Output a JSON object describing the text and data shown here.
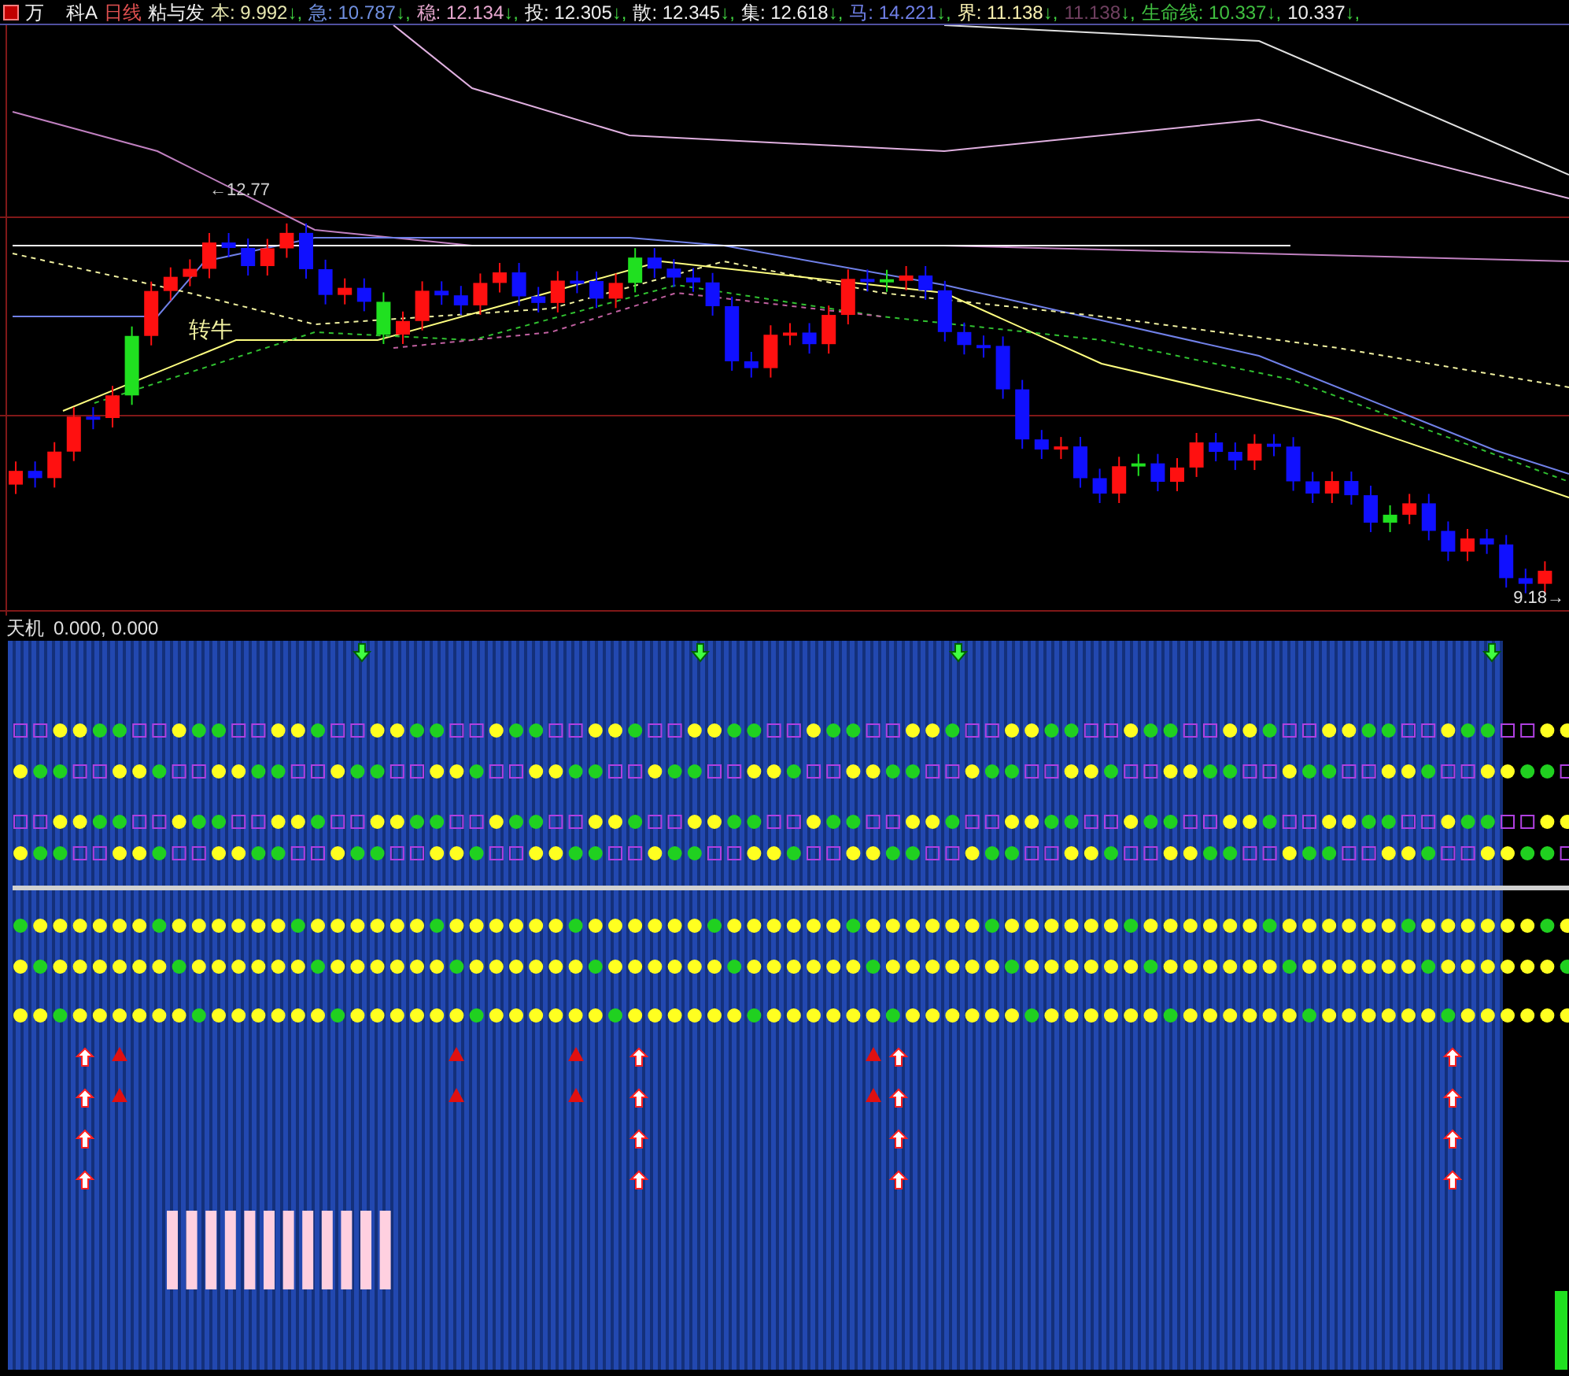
{
  "header": {
    "symbol_parts": [
      "万",
      "科A"
    ],
    "period": "日线",
    "formula": "粘与发",
    "items": [
      {
        "label": "本:",
        "value": "9.992",
        "suffix": "↓,",
        "color": "#e8e8b0"
      },
      {
        "label": "急:",
        "value": "10.787",
        "suffix": "↓,",
        "color": "#7090e0"
      },
      {
        "label": "稳:",
        "value": "12.134",
        "suffix": "↓,",
        "color": "#e8a8d0"
      },
      {
        "label": "投:",
        "value": "12.305",
        "suffix": "↓,",
        "color": "#f0f0f0"
      },
      {
        "label": "散:",
        "value": "12.345",
        "suffix": "↓,",
        "color": "#f0f0f0"
      },
      {
        "label": "集:",
        "value": "12.618",
        "suffix": "↓,",
        "color": "#f0f0f0"
      },
      {
        "label": "马:",
        "value": "14.221",
        "suffix": "↓,",
        "color": "#7080e8"
      },
      {
        "label": "界:",
        "value": "11.138",
        "suffix": "↓,",
        "color": "#f8f0b0"
      },
      {
        "value": "11.138",
        "suffix": "↓,",
        "color": "#704060"
      },
      {
        "label": "生命线:",
        "value": "10.337",
        "suffix": "↓,",
        "color": "#40c040"
      },
      {
        "value": "10.337",
        "suffix": "↓,",
        "color": "#f0f0f0"
      }
    ]
  },
  "main_chart": {
    "high_label": "←12.77",
    "signal_label": "转牛",
    "low_label": "9.18→"
  },
  "sub_panel": {
    "title": "天机",
    "values": "0.000, 0.000"
  }
}
